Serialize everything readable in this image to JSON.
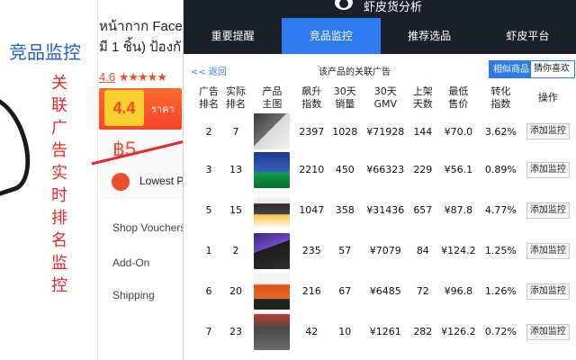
{
  "background": {
    "competitor_title": "竞品监控",
    "vertical_note": [
      "关",
      "联",
      "广",
      "告",
      "实",
      "时",
      "排",
      "名",
      "监",
      "控"
    ],
    "product_title_line1": "หน้ากาก Face",
    "product_title_line2": "มี 1 ชิ้น) ป้องกั",
    "rating_value": "4.6",
    "rating_stars": "★★★★★",
    "banner_big": "4.4",
    "banner_tail": "ราคา",
    "price": "฿5",
    "lowest_label": "Lowest P",
    "side_links": [
      "Shop Vouchers",
      "Add-On",
      "Shipping"
    ]
  },
  "panel": {
    "name": "虾皮货分析",
    "tabs": [
      {
        "label": "重要提醒",
        "active": false
      },
      {
        "label": "竞品监控",
        "active": true
      },
      {
        "label": "推荐选品",
        "active": false
      },
      {
        "label": "虾皮平台",
        "active": false
      }
    ],
    "back_label": "<< 返回",
    "caption": "该产品的关联广告",
    "btn_similar": "相似商品",
    "btn_guess": "猜你喜欢",
    "headers": [
      [
        "广告",
        "排名"
      ],
      [
        "实际",
        "排名"
      ],
      [
        "产品",
        "主图"
      ],
      [
        "飙升",
        "指数"
      ],
      [
        "30天",
        "销量"
      ],
      [
        "30天",
        "GMV"
      ],
      [
        "上架",
        "天数"
      ],
      [
        "最低",
        "售价"
      ],
      [
        "转化",
        "指数"
      ],
      [
        "操作"
      ]
    ],
    "add_label": "添加监控",
    "rows": [
      {
        "ad_rank": "2",
        "real_rank": "7",
        "surge": "2397",
        "sales30": "1028",
        "gmv30": "¥71928",
        "days": "144",
        "min_price": "¥70.0",
        "conv": "3.62%",
        "thumb": "t1"
      },
      {
        "ad_rank": "3",
        "real_rank": "13",
        "surge": "2210",
        "sales30": "450",
        "gmv30": "¥66323",
        "days": "229",
        "min_price": "¥56.1",
        "conv": "0.89%",
        "thumb": "t2"
      },
      {
        "ad_rank": "5",
        "real_rank": "15",
        "surge": "1047",
        "sales30": "358",
        "gmv30": "¥31436",
        "days": "657",
        "min_price": "¥87.8",
        "conv": "4.77%",
        "thumb": "t3"
      },
      {
        "ad_rank": "1",
        "real_rank": "2",
        "surge": "235",
        "sales30": "57",
        "gmv30": "¥7079",
        "days": "84",
        "min_price": "¥124.2",
        "conv": "1.25%",
        "thumb": "t4"
      },
      {
        "ad_rank": "6",
        "real_rank": "20",
        "surge": "216",
        "sales30": "67",
        "gmv30": "¥6485",
        "days": "72",
        "min_price": "¥96.8",
        "conv": "1.26%",
        "thumb": "t5"
      },
      {
        "ad_rank": "7",
        "real_rank": "23",
        "surge": "42",
        "sales30": "10",
        "gmv30": "¥1261",
        "days": "282",
        "min_price": "¥126.2",
        "conv": "0.72%",
        "thumb": "t6"
      }
    ]
  }
}
